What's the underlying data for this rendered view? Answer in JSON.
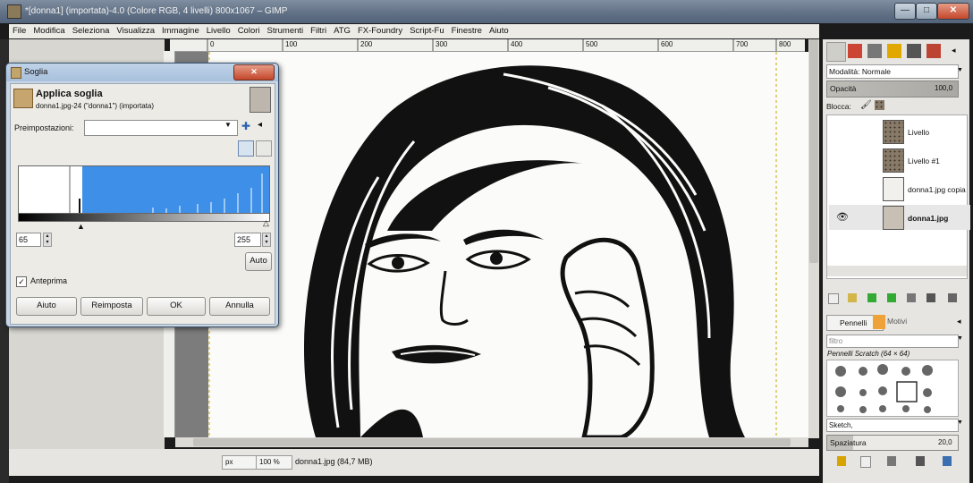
{
  "window": {
    "title": "*[donna1] (importata)-4.0 (Colore RGB, 4 livelli) 800x1067 – GIMP"
  },
  "window_buttons": [
    "—",
    "□",
    "✕"
  ],
  "menubar": [
    "File",
    "Modifica",
    "Seleziona",
    "Visualizza",
    "Immagine",
    "Livello",
    "Colori",
    "Strumenti",
    "Filtri",
    "ATG",
    "FX-Foundry",
    "Script-Fu",
    "Finestre",
    "Aiuto"
  ],
  "ruler": {
    "ticks": [
      "0",
      "100",
      "200",
      "300",
      "400",
      "500",
      "600",
      "700",
      "800"
    ]
  },
  "dialog": {
    "title": "Soglia",
    "heading": "Applica soglia",
    "subheading": "donna1.jpg-24 (\"donna1\") (importata)",
    "presets_label": "Preimpostazioni:",
    "preset_value": "",
    "low": "65",
    "high": "255",
    "auto_label": "Auto",
    "preview_label": "Anteprima",
    "preview_checked": true,
    "buttons": {
      "help": "Aiuto",
      "reset": "Reimposta",
      "ok": "OK",
      "cancel": "Annulla"
    },
    "colors": {
      "histogram_selected": "#3d8fe8"
    }
  },
  "statusbar": {
    "unit": "px",
    "zoom": "100 %",
    "info": "donna1.jpg (84,7 MB)"
  },
  "layers_panel": {
    "mode_label": "Modalità: Normale",
    "opacity_label": "Opacità",
    "opacity_value": "100,0",
    "lock_label": "Blocca:",
    "layers": [
      {
        "name": "Livello",
        "type": "checker"
      },
      {
        "name": "Livello #1",
        "type": "checker"
      },
      {
        "name": "donna1.jpg copia",
        "type": "photo"
      },
      {
        "name": "donna1.jpg",
        "type": "photo",
        "visible": true
      }
    ]
  },
  "brushes_panel": {
    "tabs": [
      "Pennelli",
      "Motivi"
    ],
    "filter_placeholder": "filtro",
    "brush_name": "Pennelli Scratch (64 × 64)",
    "brush_tag": "Sketch,",
    "spacing_label": "Spaziatura",
    "spacing_value": "20,0"
  }
}
